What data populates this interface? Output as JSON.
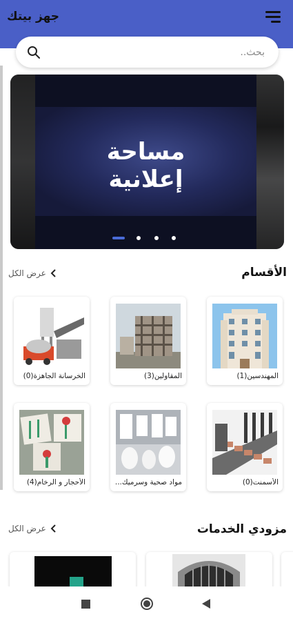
{
  "header": {
    "title": "جهز بيتك"
  },
  "search": {
    "placeholder": "بحث.."
  },
  "banner": {
    "line1": "مساحة",
    "line2": "إعلانية",
    "dot_count": 4,
    "active_dot": 0
  },
  "categories": {
    "title": "الأقسام",
    "view_all": "عرض الكل",
    "items": [
      {
        "label": "المهندسين(1)",
        "icon": "building-photo"
      },
      {
        "label": "المقاولين(3)",
        "icon": "construction-photo"
      },
      {
        "label": "الخرسانة الجاهزة(0)",
        "icon": "concrete-mixer-photo"
      },
      {
        "label": "الأسمنت(0)",
        "icon": "cement-bags-photo"
      },
      {
        "label": "مواد صحية وسرميك...",
        "icon": "sanitary-ware-photo"
      },
      {
        "label": "الأحجار و الرخام(4)",
        "icon": "tiles-photo"
      }
    ]
  },
  "providers": {
    "title": "مزودي الخدمات",
    "view_all": "عرض الكل"
  },
  "system_nav": {
    "recent": "recent-apps-icon",
    "home": "home-icon",
    "back": "back-icon"
  },
  "colors": {
    "accent": "#4a5fc7",
    "dot_active": "#4a6bd8"
  }
}
